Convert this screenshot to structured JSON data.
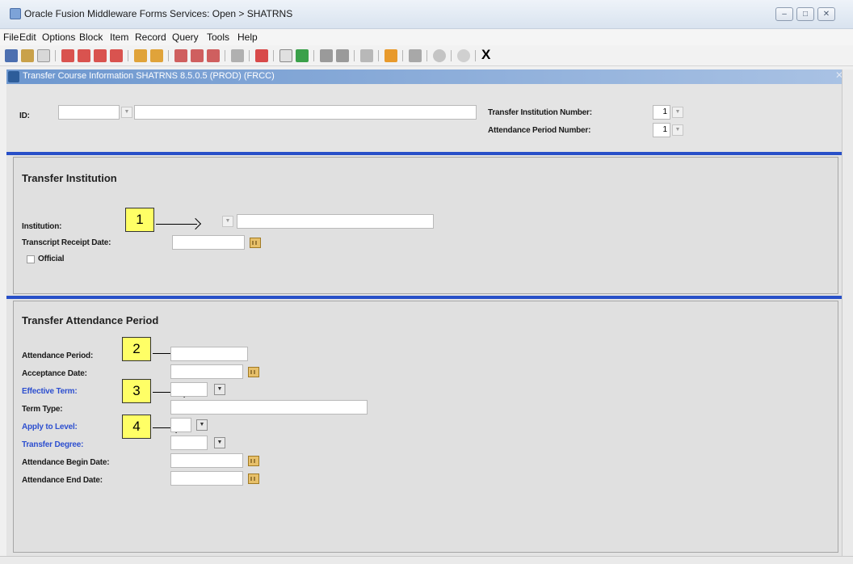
{
  "window": {
    "title": "Oracle Fusion Middleware Forms Services: Open > SHATRNS",
    "controls": {
      "minimize": "–",
      "maximize": "□",
      "close": "✕"
    }
  },
  "menu": [
    "File",
    "Edit",
    "Options",
    "Block",
    "Item",
    "Record",
    "Query",
    "Tools",
    "Help"
  ],
  "toolbar": {
    "exit_label": "X"
  },
  "form": {
    "title": "Transfer Course Information  SHATRNS  8.5.0.5  (PROD)  (FRCC)",
    "close_glyph": "✕"
  },
  "key_block": {
    "id_label": "ID:",
    "id_value": "",
    "name_value": "",
    "transfer_institution_number_label": "Transfer Institution Number:",
    "transfer_institution_number_value": "1",
    "attendance_period_number_label": "Attendance Period Number:",
    "attendance_period_number_value": "1"
  },
  "transfer_institution": {
    "title": "Transfer Institution",
    "institution_label": "Institution:",
    "transcript_receipt_date_label": "Transcript Receipt Date:",
    "official_label": "Official"
  },
  "transfer_attendance_period": {
    "title": "Transfer Attendance Period",
    "attendance_period_label": "Attendance Period:",
    "acceptance_date_label": "Acceptance Date:",
    "effective_term_label": "Effective Term:",
    "term_type_label": "Term Type:",
    "apply_to_level_label": "Apply to Level:",
    "transfer_degree_label": "Transfer Degree:",
    "attendance_begin_date_label": "Attendance Begin Date:",
    "attendance_end_date_label": "Attendance End Date:"
  },
  "callouts": [
    "1",
    "2",
    "3",
    "4"
  ],
  "colors": {
    "section_rule": "#2850c8",
    "required_label": "#2d4fcf",
    "callout_fill": "#ffff66",
    "form_header": "#6d97cf"
  }
}
